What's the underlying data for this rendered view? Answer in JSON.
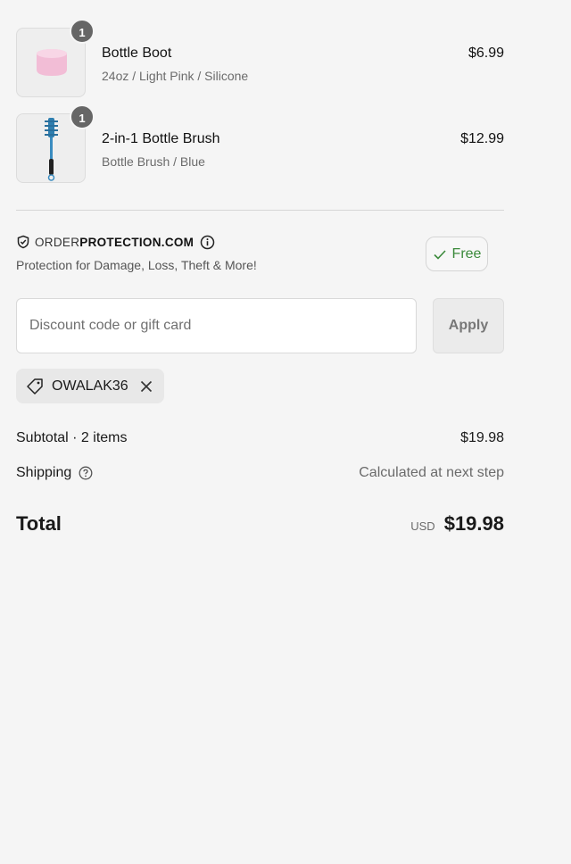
{
  "line_items": [
    {
      "quantity": "1",
      "title": "Bottle Boot",
      "variant": "24oz / Light Pink / Silicone",
      "price": "$6.99",
      "image_icon": "pink-silicone-boot"
    },
    {
      "quantity": "1",
      "title": "2-in-1 Bottle Brush",
      "variant": "Bottle Brush / Blue",
      "price": "$12.99",
      "image_icon": "blue-bottle-brush"
    }
  ],
  "order_protection": {
    "logo_light": "ORDER",
    "logo_bold": "PROTECTION.COM",
    "description": "Protection for Damage, Loss, Theft & More!",
    "toggle_label": "Free",
    "icons": [
      "shield-check-icon",
      "info-icon",
      "check-icon"
    ]
  },
  "discount": {
    "placeholder": "Discount code or gift card",
    "apply_label": "Apply",
    "applied_code": "OWALAK36"
  },
  "totals": {
    "subtotal_label": "Subtotal · 2 items",
    "subtotal_value": "$19.98",
    "shipping_label": "Shipping",
    "shipping_value": "Calculated at next step",
    "total_label": "Total",
    "currency": "USD",
    "total_value": "$19.98"
  },
  "colors": {
    "background": "#f5f5f5",
    "free_green": "#3b8a3b",
    "badge": "#666666"
  }
}
